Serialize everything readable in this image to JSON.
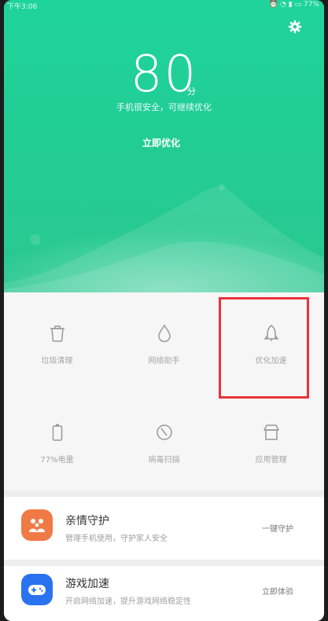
{
  "status_bar": {
    "time": "下午3:06",
    "battery": "77%"
  },
  "hero": {
    "score": "80",
    "score_unit": "分",
    "subtitle": "手机很安全，可继续优化",
    "optimize_label": "立即优化"
  },
  "grid": {
    "items": [
      {
        "label": "垃圾清理",
        "icon": "trash-icon"
      },
      {
        "label": "网络助手",
        "icon": "water-drop-icon"
      },
      {
        "label": "优化加速",
        "icon": "rocket-icon"
      },
      {
        "label": "77%电量",
        "icon": "battery-icon"
      },
      {
        "label": "病毒扫描",
        "icon": "scan-icon"
      },
      {
        "label": "应用管理",
        "icon": "app-box-icon"
      }
    ]
  },
  "cards": [
    {
      "title": "亲情守护",
      "desc": "管理手机使用，守护家人安全",
      "action": "一键守护",
      "icon": "family-icon",
      "color": "#f07a45"
    },
    {
      "title": "游戏加速",
      "desc": "开启网络加速，提升游戏网络稳定性",
      "action": "立即体验",
      "icon": "gamepad-icon",
      "color": "#2a73f0"
    }
  ],
  "colors": {
    "hero": "#22cc92",
    "highlight": "#e8343b",
    "label": "#a6a6a6"
  }
}
